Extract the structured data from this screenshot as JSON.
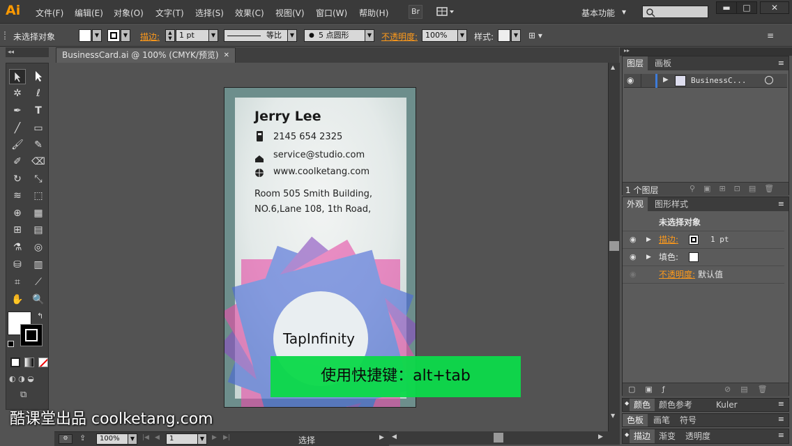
{
  "app": {
    "logo": "Ai",
    "menus": [
      "文件(F)",
      "编辑(E)",
      "对象(O)",
      "文字(T)",
      "选择(S)",
      "效果(C)",
      "视图(V)",
      "窗口(W)",
      "帮助(H)"
    ],
    "bridge_label": "Br",
    "workspace": "基本功能",
    "workspace_arrow": "▾",
    "win_controls": [
      "▬",
      "□",
      "✕"
    ]
  },
  "control_bar": {
    "selection_status": "未选择对象",
    "stroke_label": "描边:",
    "stroke_weight": "1 pt",
    "stroke_profile": "等比",
    "brush": "5 点圆形",
    "opacity_label": "不透明度:",
    "opacity_value": "100%",
    "style_label": "样式:"
  },
  "document": {
    "tab_title": "BusinessCard.ai @ 100% (CMYK/预览)",
    "tab_close": "✕"
  },
  "card": {
    "name": "Jerry Lee",
    "phone": "2145 654 2325",
    "email": "service@studio.com",
    "website": "www.coolketang.com",
    "address_line1": "Room 505 Smith Building,",
    "address_line2": "NO.6,Lane 108, 1th Road,",
    "company": "TapInfinity"
  },
  "overlay": {
    "shortcut_hint": "使用快捷键：alt+tab"
  },
  "watermark": "酷课堂出品 coolketang.com",
  "status": {
    "zoom": "100%",
    "page": "1",
    "tool_status": "选择"
  },
  "layers_panel": {
    "tabs": [
      "图层",
      "画板"
    ],
    "layer_name": "BusinessC...",
    "layer_count": "1 个图层"
  },
  "appearance_panel": {
    "tabs": [
      "外观",
      "图形样式"
    ],
    "title": "未选择对象",
    "stroke_label": "描边:",
    "stroke_value": "1 pt",
    "fill_label": "填色:",
    "opacity_label": "不透明度:",
    "opacity_value": "默认值"
  },
  "collapsed_panels": {
    "row1": [
      "颜色",
      "颜色参考",
      "Kuler"
    ],
    "row2": [
      "色板",
      "画笔",
      "符号"
    ],
    "row3": [
      "描边",
      "渐变",
      "透明度"
    ]
  },
  "colors": {
    "accent_orange": "#ff9a1a",
    "overlay_green": "#0dd94a",
    "layer_blue": "#3d7bd9",
    "flower_pink": "#e64fa8",
    "flower_blue": "#4a6ad8",
    "flower_purple": "#8a4ec0"
  }
}
